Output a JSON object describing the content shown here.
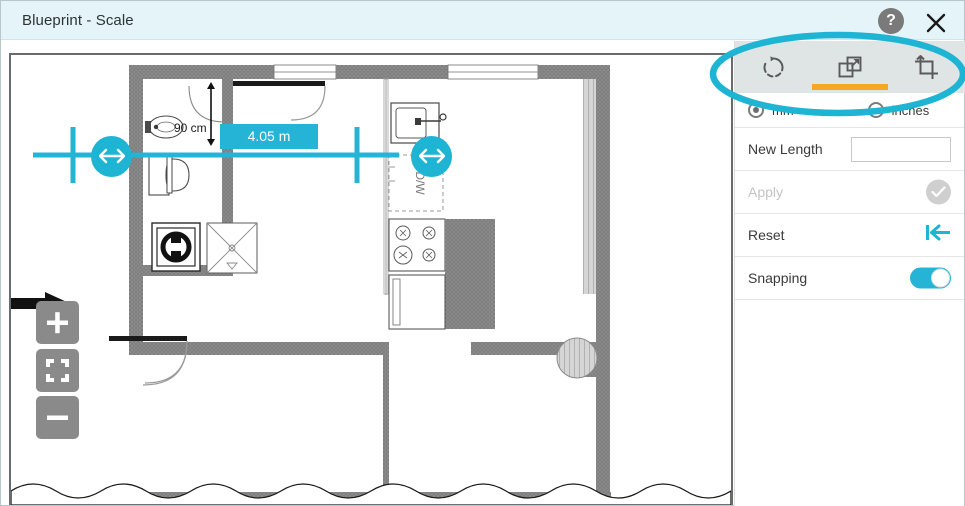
{
  "window": {
    "title": "Blueprint - Scale",
    "help_icon": "question-mark-icon",
    "help_label": "?",
    "close_icon": "close-icon"
  },
  "canvas": {
    "measurement": {
      "value_label": "4.05 m",
      "secondary_label": "90 cm",
      "line_color": "#25b4d6",
      "handle_icon": "horizontal-resize-arrow-icon"
    },
    "zoom_controls": [
      {
        "name": "zoom-in",
        "icon": "plus-icon"
      },
      {
        "name": "zoom-fit",
        "icon": "fit-to-screen-icon"
      },
      {
        "name": "zoom-out",
        "icon": "minus-icon"
      }
    ],
    "plan_labels": {
      "dishwasher": "D/W"
    },
    "wall_color": "#808080",
    "background": "#ffffff"
  },
  "panel": {
    "tools": [
      {
        "name": "rotate",
        "icon": "rotate-icon",
        "active": false
      },
      {
        "name": "scale",
        "icon": "scale-resize-icon",
        "active": true
      },
      {
        "name": "crop",
        "icon": "crop-icon",
        "active": false
      }
    ],
    "active_indicator_color": "#f5a623",
    "units": {
      "options": [
        {
          "label": "mm",
          "selected": true
        },
        {
          "label": "inches",
          "selected": false
        }
      ]
    },
    "new_length": {
      "label": "New Length",
      "value": "",
      "placeholder": ""
    },
    "apply": {
      "label": "Apply",
      "enabled": false,
      "icon": "check-circle-icon"
    },
    "reset": {
      "label": "Reset",
      "icon": "skip-back-arrow-icon",
      "icon_color": "#1eb4d4"
    },
    "snapping": {
      "label": "Snapping",
      "enabled": true,
      "color": "#25b4d6"
    }
  },
  "annotation": {
    "type": "ellipse-highlight",
    "color": "#1eb4d4",
    "target": "tool-tabs"
  }
}
